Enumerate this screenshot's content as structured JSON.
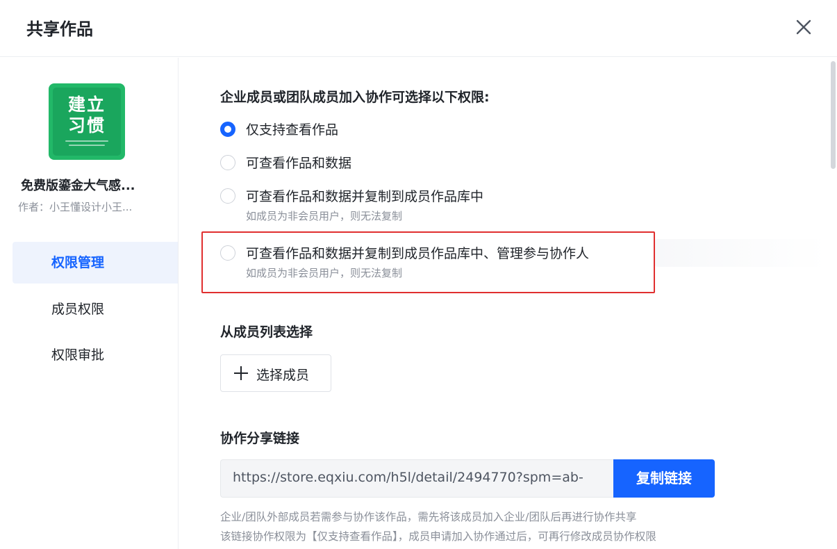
{
  "header": {
    "title": "共享作品",
    "close_icon": "close-icon"
  },
  "work": {
    "cover_text_line1": "建立",
    "cover_text_line2": "习惯",
    "name": "免费版鎏金大气感...",
    "author": "作者：小王懂设计小王..."
  },
  "sidebar": {
    "items": [
      {
        "label": "权限管理",
        "active": true
      },
      {
        "label": "成员权限",
        "active": false
      },
      {
        "label": "权限审批",
        "active": false
      }
    ]
  },
  "permissions": {
    "title": "企业成员或团队成员加入协作可选择以下权限:",
    "options": [
      {
        "label": "仅支持查看作品",
        "sub": "",
        "checked": true
      },
      {
        "label": "可查看作品和数据",
        "sub": "",
        "checked": false
      },
      {
        "label": "可查看作品和数据并复制到成员作品库中",
        "sub": "如成员为非会员用户，则无法复制",
        "checked": false
      },
      {
        "label": "可查看作品和数据并复制到成员作品库中、管理参与协作人",
        "sub": "如成员为非会员用户，则无法复制",
        "checked": false
      }
    ]
  },
  "members": {
    "title": "从成员列表选择",
    "choose_button": "选择成员"
  },
  "share_link": {
    "title": "协作分享链接",
    "url": "https://store.eqxiu.com/h5l/detail/2494770?spm=ab-",
    "copy_button": "复制链接",
    "note_line1": "企业/团队外部成员若需参与协作该作品，需先将该成员加入企业/团队后再进行协作共享",
    "note_line2": "该链接协作权限为【仅支持查看作品】，成员申请加入协作通过后，可再行修改成员协作权限"
  },
  "colors": {
    "accent": "#1664ff",
    "highlight_border": "#e02f2f",
    "cover_green": "#22b868"
  }
}
